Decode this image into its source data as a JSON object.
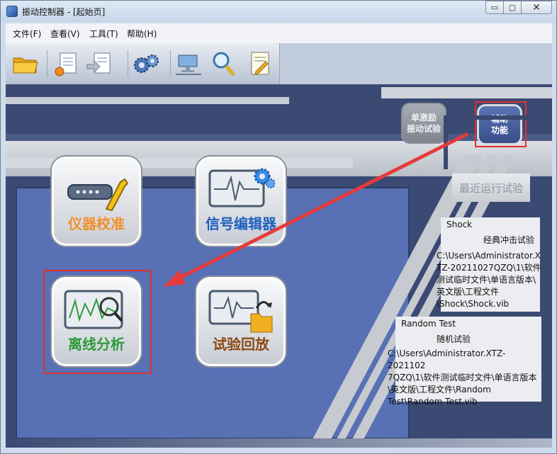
{
  "window": {
    "title": "振动控制器 - [起始页]",
    "buttons": {
      "minimize": "▭",
      "maximize": "▢",
      "close": "✕"
    }
  },
  "menu": {
    "items": [
      "文件(F)",
      "查看(V)",
      "工具(T)",
      "帮助(H)"
    ]
  },
  "toolbar": {
    "icons": [
      "folder-open-icon",
      "new-document-icon",
      "import-icon",
      "settings-gears-icon",
      "network-computer-icon",
      "search-wrench-icon",
      "document-edit-icon"
    ]
  },
  "side_buttons": {
    "single_excitation": "单激励\n振动试验",
    "aux_functions": "辅助\n功能"
  },
  "main_buttons": {
    "instrument_calibration": "仪器校准",
    "signal_editor": "信号编辑器",
    "offline_analysis": "离线分析",
    "test_replay": "试验回放"
  },
  "recent": {
    "title": "最近运行试验",
    "items": [
      {
        "name": "Shock",
        "type": "经典冲击试验",
        "path_lines": [
          "C:\\Users\\Administrator.X",
          "TZ-20211027QZQ\\1\\软件",
          "测试临时文件\\单语言版本\\",
          "英文版\\工程文件",
          "\\Shock\\Shock.vib"
        ]
      },
      {
        "name": "Random Test",
        "type": "随机试验",
        "path_lines": [
          "C:\\Users\\Administrator.XTZ-2021102",
          "7QZQ\\1\\软件测试临时文件\\单语言版本",
          "\\英文版\\工程文件\\Random",
          "Test\\Random Test.vib"
        ]
      }
    ]
  },
  "colors": {
    "dark_navy": "#3b4a73",
    "panel_blue": "#5870b4",
    "highlight_red": "#e03030",
    "label_orange": "#f0902a",
    "label_blue": "#1f5fc0",
    "label_green": "#2f9a3a",
    "label_brown": "#8a4a14"
  }
}
